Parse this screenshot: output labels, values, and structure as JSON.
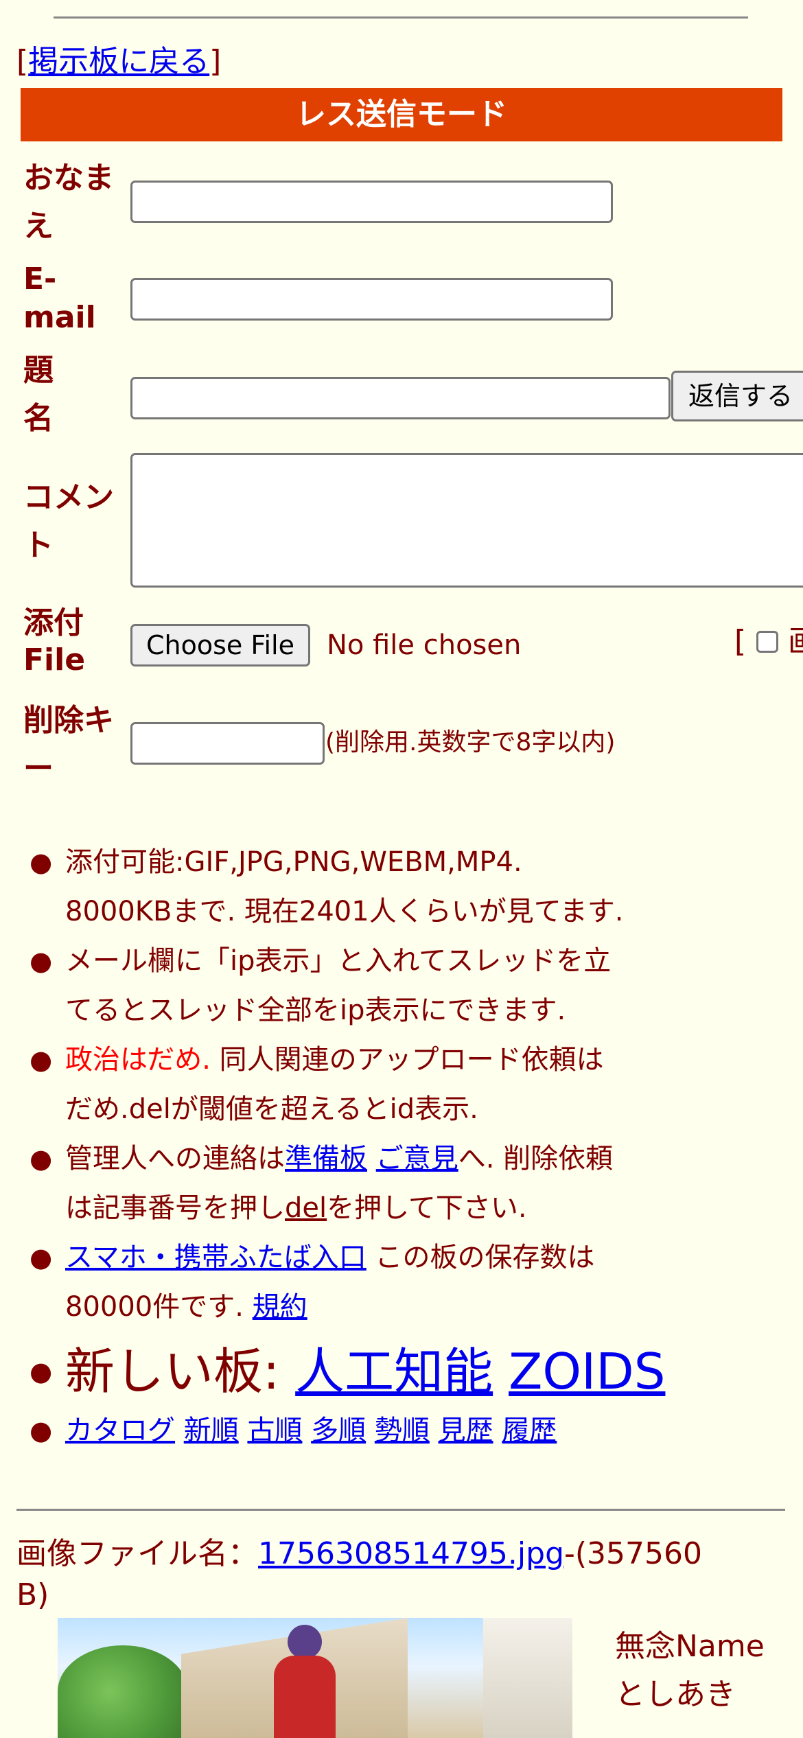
{
  "back_link": {
    "bracket_open": "[",
    "label": "掲示板に戻る",
    "bracket_close": "]"
  },
  "banner": {
    "title": "レス送信モード"
  },
  "form": {
    "name_label_1": "おなま",
    "name_label_2": "え",
    "email_label_1": "E-",
    "email_label_2": "mail",
    "subject_label_1": "題",
    "subject_label_2": "名",
    "submit_label": "返信する",
    "comment_label_1": "コメン",
    "comment_label_2": "ト",
    "file_label_1": "添付",
    "file_label_2": "File",
    "choose_file_label": "Choose File",
    "no_file_text": "No file chosen",
    "image_option_bracket": "[",
    "image_option_text": "画",
    "delkey_label_1": "削除キ",
    "delkey_label_2": "ー",
    "delkey_note": "(削除用.英数字で8字以内)"
  },
  "rules": {
    "r1_line1": "添付可能:GIF,JPG,PNG,WEBM,MP4.",
    "r1_line2": "8000KBまで. 現在2401人くらいが見てます.",
    "r2_line1": "メール欄に「ip表示」と入れてスレッドを立",
    "r2_line2": "てるとスレッド全部をip表示にできます.",
    "r3_red": "政治はだめ.",
    "r3_rest": " 同人関連のアップロード依頼は",
    "r3_line2": "だめ.delが閾値を超えるとid表示.",
    "r4_pre": "管理人への連絡は",
    "r4_link1": "準備板",
    "r4_link2": "ご意見",
    "r4_post": "へ. 削除依頼",
    "r4_line2_pre": "は記事番号を押し",
    "r4_link3": "del",
    "r4_line2_post": "を押して下さい.",
    "r5_link": "スマホ・携帯ふたば入口",
    "r5_text": " この板の保存数は",
    "r5_line2": "80000件です. ",
    "r5_link2": "規約",
    "r6_text": "新しい板: ",
    "r6_link1": "人工知能",
    "r6_link2": "ZOIDS",
    "nav": [
      "カタログ",
      "新順",
      "古順",
      "多順",
      "勢順",
      "見歴",
      "履歴"
    ]
  },
  "thread": {
    "file_label": "画像ファイル名：",
    "file_name": "1756308514795.jpg",
    "file_size_1": "-(357560",
    "file_size_2": "B)",
    "poster_name": "無念Name",
    "poster_name2": "としあき"
  }
}
